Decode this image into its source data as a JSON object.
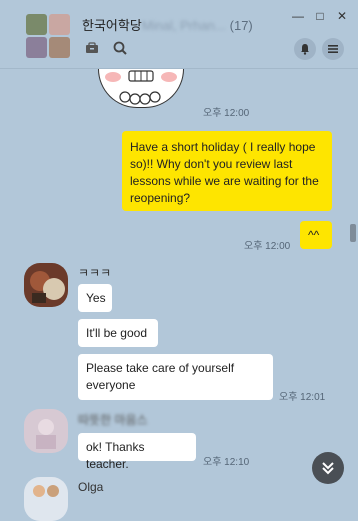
{
  "header": {
    "title": "한국어학당",
    "title_blurred": "Minal, Prhan...",
    "member_count": "(17)",
    "minimize": "—",
    "maximize": "□",
    "close": "✕"
  },
  "messages": [
    {
      "id": "sticker_time",
      "time": "오후 12:00"
    },
    {
      "id": "m1",
      "text": "Have a short holiday ( I really hope so)!! Why don't you review last lessons while we are waiting for the reopening?"
    },
    {
      "id": "m2",
      "text": "^^",
      "time": "오후 12:00"
    },
    {
      "id": "sender1",
      "name": "ㅋㅋㅋ"
    },
    {
      "id": "m3",
      "text": "Yes"
    },
    {
      "id": "m4",
      "text": "It'll be good"
    },
    {
      "id": "m5",
      "text": "Please take care of yourself everyone",
      "time": "오후 12:01"
    },
    {
      "id": "sender2",
      "name": "따뜻한 마음스"
    },
    {
      "id": "m6",
      "text": "ok! Thanks teacher.",
      "time": "오후 12:10"
    },
    {
      "id": "sender3",
      "name": "Olga"
    }
  ],
  "colors": {
    "background": "#b2c7d9",
    "my_bubble": "#fee500",
    "other_bubble": "#ffffff"
  }
}
